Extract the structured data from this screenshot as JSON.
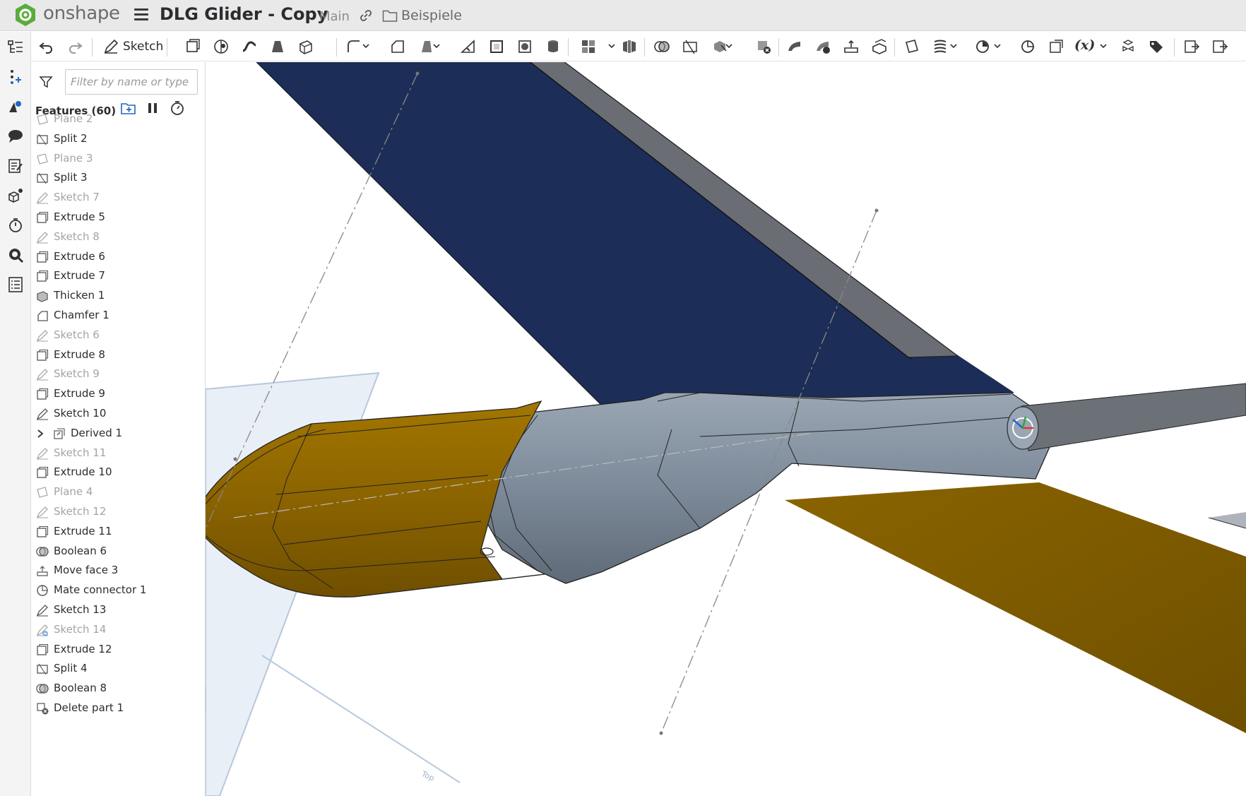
{
  "header": {
    "brand": "onshape",
    "document_title": "DLG Glider - Copy",
    "branch": "Main",
    "folder": "Beispiele"
  },
  "toolbar": {
    "sketch_label": "Sketch",
    "variable_label": "(x)",
    "icons": [
      "undo-icon",
      "redo-icon",
      "sketch-icon",
      "extrude-icon",
      "revolve-icon",
      "sweep-icon",
      "loft-icon",
      "thicken-icon",
      "fillet-icon",
      "chamfer-icon",
      "draft-icon",
      "rib-icon",
      "shell-icon",
      "hole-icon",
      "cylinder-icon",
      "pattern-icon",
      "mirror-icon",
      "boolean-icon",
      "split-icon",
      "transform-icon",
      "delete-part-icon",
      "modify-fillet-icon",
      "delete-face-icon",
      "move-face-icon",
      "replace-face-icon",
      "plane-icon",
      "helix-icon",
      "mate-connector-icon",
      "derived-icon",
      "variable-icon",
      "configuration-icon",
      "tag-icon",
      "import-icon",
      "explode-icon"
    ]
  },
  "rail": {
    "icons": [
      "feature-list-icon",
      "add-instance-icon",
      "appearance-icon",
      "comments-icon",
      "notes-icon",
      "parts-icon",
      "history-icon",
      "search-icon",
      "properties-icon"
    ]
  },
  "features": {
    "filter_placeholder": "Filter by name or type",
    "header": "Features (60)",
    "items": [
      {
        "label": "Plane 2",
        "icon": "plane-icon",
        "dim": true
      },
      {
        "label": "Split 2",
        "icon": "split-icon",
        "dim": false
      },
      {
        "label": "Plane 3",
        "icon": "plane-icon",
        "dim": true
      },
      {
        "label": "Split 3",
        "icon": "split-icon",
        "dim": false
      },
      {
        "label": "Sketch 7",
        "icon": "sketch-icon",
        "dim": true
      },
      {
        "label": "Extrude 5",
        "icon": "extrude-icon",
        "dim": false
      },
      {
        "label": "Sketch 8",
        "icon": "sketch-icon",
        "dim": true
      },
      {
        "label": "Extrude 6",
        "icon": "extrude-icon",
        "dim": false
      },
      {
        "label": "Extrude 7",
        "icon": "extrude-icon",
        "dim": false
      },
      {
        "label": "Thicken 1",
        "icon": "thicken-icon",
        "dim": false
      },
      {
        "label": "Chamfer 1",
        "icon": "chamfer-icon",
        "dim": false
      },
      {
        "label": "Sketch 6",
        "icon": "sketch-icon",
        "dim": true
      },
      {
        "label": "Extrude 8",
        "icon": "extrude-icon",
        "dim": false
      },
      {
        "label": "Sketch 9",
        "icon": "sketch-icon",
        "dim": true
      },
      {
        "label": "Extrude 9",
        "icon": "extrude-icon",
        "dim": false
      },
      {
        "label": "Sketch 10",
        "icon": "sketch-icon",
        "dim": false
      },
      {
        "label": "Derived 1",
        "icon": "derived-icon",
        "dim": false,
        "folder": true
      },
      {
        "label": "Sketch 11",
        "icon": "sketch-icon",
        "dim": true
      },
      {
        "label": "Extrude 10",
        "icon": "extrude-icon",
        "dim": false
      },
      {
        "label": "Plane 4",
        "icon": "plane-icon",
        "dim": true
      },
      {
        "label": "Sketch 12",
        "icon": "sketch-icon",
        "dim": true
      },
      {
        "label": "Extrude 11",
        "icon": "extrude-icon",
        "dim": false
      },
      {
        "label": "Boolean 6",
        "icon": "boolean-icon",
        "dim": false
      },
      {
        "label": "Move face 3",
        "icon": "move-face-icon",
        "dim": false
      },
      {
        "label": "Mate connector 1",
        "icon": "mate-connector-icon",
        "dim": false
      },
      {
        "label": "Sketch 13",
        "icon": "sketch-icon",
        "dim": false
      },
      {
        "label": "Sketch 14",
        "icon": "sketch-icon",
        "dim": true,
        "error": true
      },
      {
        "label": "Extrude 12",
        "icon": "extrude-icon",
        "dim": false
      },
      {
        "label": "Split 4",
        "icon": "split-icon",
        "dim": false
      },
      {
        "label": "Boolean 8",
        "icon": "boolean-icon",
        "dim": false
      },
      {
        "label": "Delete part 1",
        "icon": "delete-part-icon",
        "dim": false
      }
    ]
  },
  "colors": {
    "accent": "#2067c6",
    "wing_blue": "#1c2d57",
    "fuselage_gold": "#8a6200",
    "fuselage_gray": "#7a8898",
    "logo_green": "#4caf50"
  }
}
